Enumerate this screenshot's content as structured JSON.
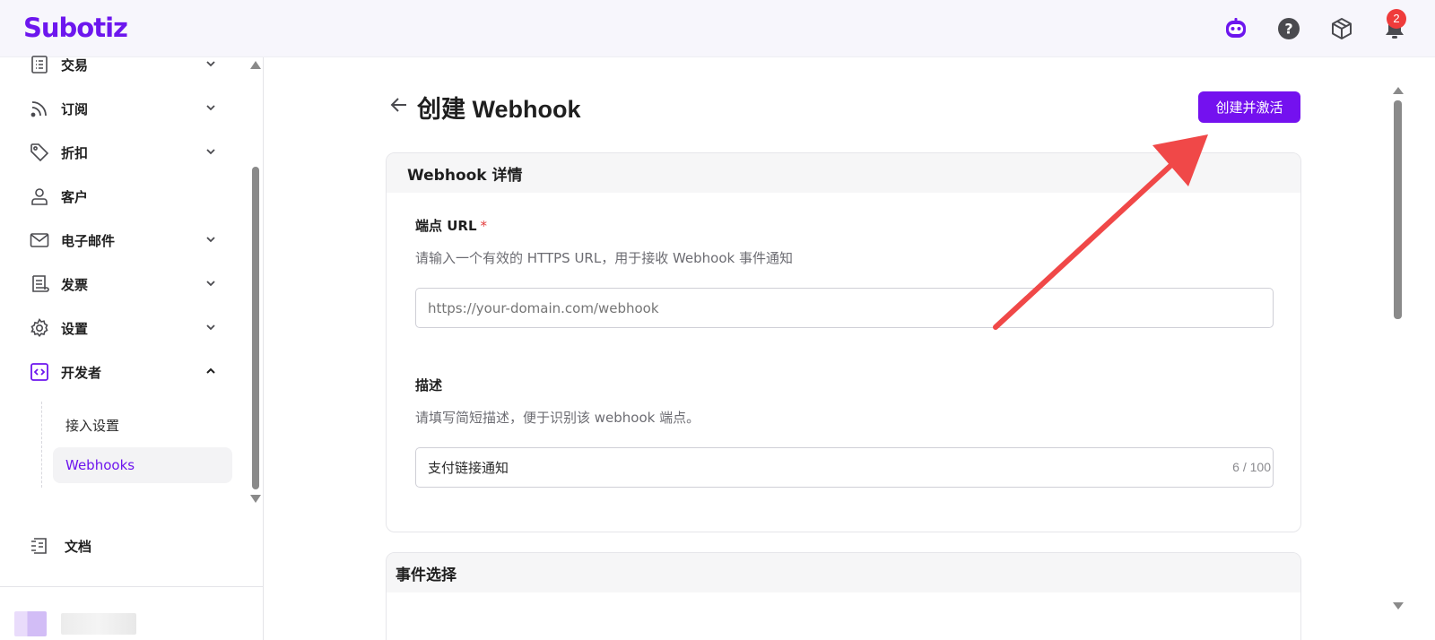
{
  "app": {
    "logo_text": "Subotiz",
    "brand_color": "#6d16ee",
    "notification_count": "2"
  },
  "header": {
    "icons": [
      "assistant-bot-icon",
      "help-icon",
      "package-icon",
      "bell-icon"
    ]
  },
  "sidebar": {
    "items": [
      {
        "label": "交易",
        "icon": "list-icon",
        "expandable": true
      },
      {
        "label": "订阅",
        "icon": "rss-icon",
        "expandable": true
      },
      {
        "label": "折扣",
        "icon": "tag-icon",
        "expandable": true
      },
      {
        "label": "客户",
        "icon": "user-icon",
        "expandable": false
      },
      {
        "label": "电子邮件",
        "icon": "mail-icon",
        "expandable": true
      },
      {
        "label": "发票",
        "icon": "receipt-icon",
        "expandable": true
      },
      {
        "label": "设置",
        "icon": "gear-icon",
        "expandable": true
      },
      {
        "label": "开发者",
        "icon": "code-icon",
        "expandable": true,
        "expanded": true
      }
    ],
    "developer_children": [
      {
        "label": "接入设置"
      },
      {
        "label": "Webhooks",
        "active": true
      }
    ],
    "docs": {
      "label": "文档",
      "icon": "docs-icon"
    }
  },
  "page": {
    "title": "创建 Webhook",
    "primary_button": "创建并激活"
  },
  "details_card": {
    "title": "Webhook 详情",
    "endpoint": {
      "label": "端点 URL",
      "required_mark": "*",
      "help": "请输入一个有效的 HTTPS URL，用于接收 Webhook 事件通知",
      "placeholder": "https://your-domain.com/webhook",
      "value": ""
    },
    "description": {
      "label": "描述",
      "help": "请填写简短描述，便于识别该 webhook 端点。",
      "value": "支付链接通知",
      "counter": "6 / 100"
    }
  },
  "events_card": {
    "title": "事件选择"
  }
}
